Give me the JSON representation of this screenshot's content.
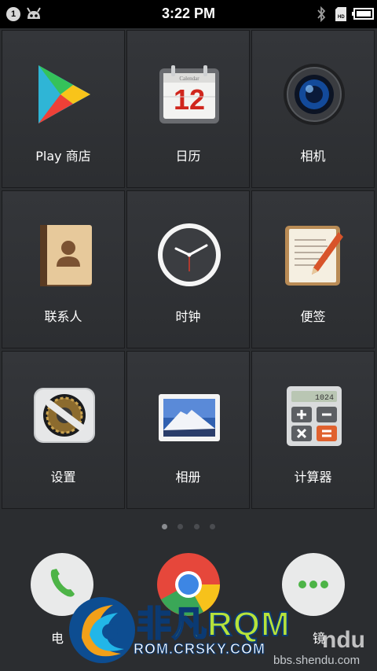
{
  "status_bar": {
    "notification_count": "1",
    "time": "3:22 PM",
    "icons": [
      "cyanogen-notification-icon",
      "bluetooth-icon",
      "sd-card-icon",
      "battery-icon"
    ]
  },
  "apps": [
    {
      "label": "Play 商店",
      "icon": "play-store-icon"
    },
    {
      "label": "日历",
      "icon": "calendar-icon",
      "icon_text": "Calendar",
      "icon_number": "12"
    },
    {
      "label": "相机",
      "icon": "camera-icon"
    },
    {
      "label": "联系人",
      "icon": "contacts-icon"
    },
    {
      "label": "时钟",
      "icon": "clock-icon"
    },
    {
      "label": "便签",
      "icon": "notes-icon"
    },
    {
      "label": "设置",
      "icon": "settings-icon"
    },
    {
      "label": "相册",
      "icon": "gallery-icon"
    },
    {
      "label": "计算器",
      "icon": "calculator-icon",
      "icon_text": "1024"
    }
  ],
  "pager": {
    "pages": 4,
    "active": 0
  },
  "dock": [
    {
      "label": "电",
      "icon": "phone-icon"
    },
    {
      "label": "",
      "icon": "chrome-icon"
    },
    {
      "label": "镜",
      "icon": "messaging-icon"
    }
  ],
  "watermark": {
    "title": "非凡RQM",
    "subtitle": "ROM.CRSKY.COM",
    "site": "bbs.shendu.com",
    "brand_fragment": "ndu"
  },
  "colors": {
    "background": "#2b2d30",
    "watermark_green": "#b6e23b",
    "watermark_blue": "#0b3a73"
  }
}
